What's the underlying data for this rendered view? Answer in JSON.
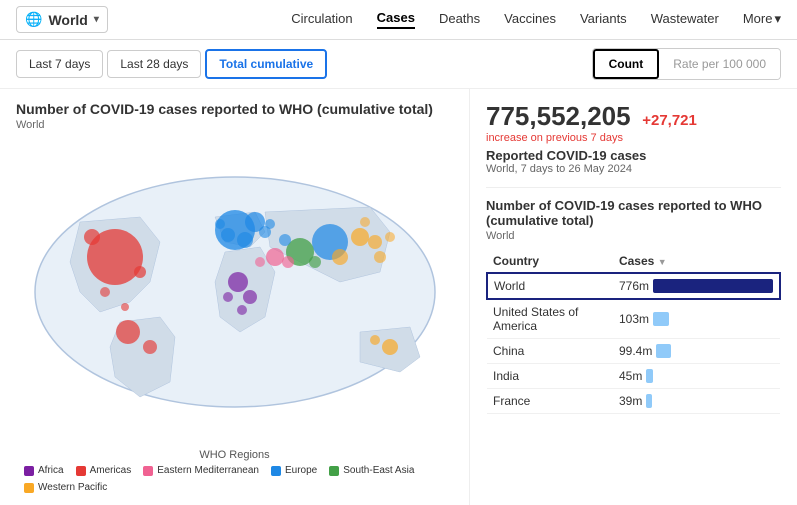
{
  "header": {
    "world_label": "World",
    "chevron": "▾",
    "nav": [
      {
        "label": "Circulation",
        "active": false
      },
      {
        "label": "Cases",
        "active": true
      },
      {
        "label": "Deaths",
        "active": false
      },
      {
        "label": "Vaccines",
        "active": false
      },
      {
        "label": "Variants",
        "active": false
      },
      {
        "label": "Wastewater",
        "active": false
      },
      {
        "label": "More",
        "active": false
      }
    ]
  },
  "sub_header": {
    "tabs": [
      {
        "label": "Last 7 days",
        "active": false
      },
      {
        "label": "Last 28 days",
        "active": false
      },
      {
        "label": "Total cumulative",
        "active": true
      }
    ],
    "count_label": "Count",
    "rate_label": "Rate per 100 000"
  },
  "left_panel": {
    "title": "Number of COVID-19 cases reported to WHO (cumulative total)",
    "subtitle": "World"
  },
  "legend": {
    "title": "WHO Regions",
    "items": [
      {
        "label": "Africa",
        "color": "#7B1FA2"
      },
      {
        "label": "Americas",
        "color": "#E53935"
      },
      {
        "label": "Eastern Mediterranean",
        "color": "#F06292"
      },
      {
        "label": "Europe",
        "color": "#1E88E5"
      },
      {
        "label": "South-East Asia",
        "color": "#43A047"
      },
      {
        "label": "Western Pacific",
        "color": "#F9A825"
      }
    ]
  },
  "right_panel": {
    "stat_number": "775,552,205",
    "stat_increase": "+27,721",
    "stat_increase_label": "increase on previous 7 days",
    "stat_label": "Reported COVID-19 cases",
    "stat_meta": "World, 7 days to 26 May 2024",
    "chart_title": "Number of COVID-19 cases reported to WHO (cumulative total)",
    "chart_subtitle": "World",
    "table": {
      "col1": "Country",
      "col2": "Cases",
      "rows": [
        {
          "country": "World",
          "cases": "776m",
          "bar_class": "bar bar-world",
          "highlight": true
        },
        {
          "country": "United States of America",
          "cases": "103m",
          "bar_class": "bar bar-usa",
          "highlight": false
        },
        {
          "country": "China",
          "cases": "99.4m",
          "bar_class": "bar bar-china",
          "highlight": false
        },
        {
          "country": "India",
          "cases": "45m",
          "bar_class": "bar bar-india",
          "highlight": false
        },
        {
          "country": "France",
          "cases": "39m",
          "bar_class": "bar bar-france",
          "highlight": false
        }
      ]
    }
  }
}
